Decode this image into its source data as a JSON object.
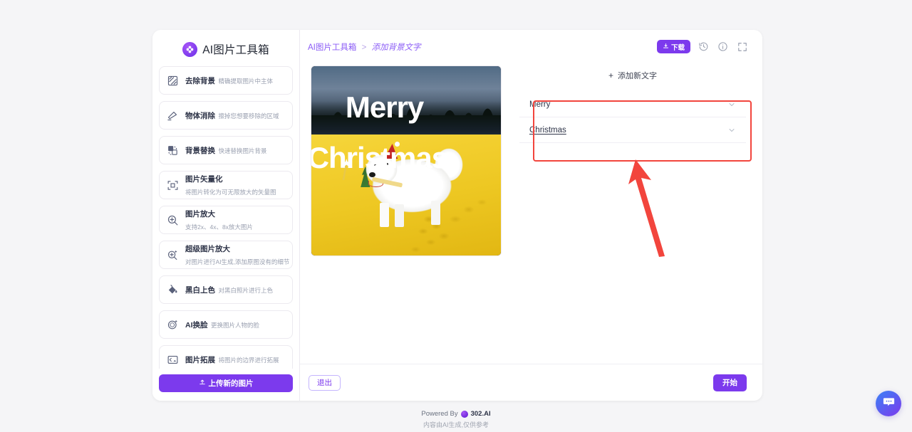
{
  "brand": {
    "title": "AI图片工具箱",
    "logo_icon": "clover-logo-icon"
  },
  "sidebar": {
    "items": [
      {
        "name": "去除背景",
        "desc": "精确提取图片中主体",
        "icon": "remove-background-icon"
      },
      {
        "name": "物体消除",
        "desc": "擦掉您想要移除的区域",
        "icon": "eraser-icon"
      },
      {
        "name": "背景替换",
        "desc": "快速替换图片背景",
        "icon": "background-replace-icon"
      },
      {
        "name": "图片矢量化",
        "desc": "将图片转化为可无限放大的矢量图",
        "icon": "vectorize-icon"
      },
      {
        "name": "图片放大",
        "desc": "支持2x、4x、8x放大图片",
        "icon": "zoom-in-icon"
      },
      {
        "name": "超级图片放大",
        "desc": "对图片进行AI生成,添加原图没有的细节",
        "icon": "super-zoom-icon"
      },
      {
        "name": "黑白上色",
        "desc": "对黑白照片进行上色",
        "icon": "paint-bucket-icon"
      },
      {
        "name": "AI换脸",
        "desc": "更换图片人物的脸",
        "icon": "face-swap-icon"
      },
      {
        "name": "图片拓展",
        "desc": "将图片的边界进行拓展",
        "icon": "image-expand-icon"
      }
    ],
    "upload_label": "上传新的图片",
    "upload_icon": "upload-icon"
  },
  "header": {
    "breadcrumb_root": "AI图片工具箱",
    "breadcrumb_sep": ">",
    "breadcrumb_current": "添加背景文字",
    "download_label": "下载",
    "download_icon": "download-icon",
    "history_icon": "history-icon",
    "info_icon": "info-icon",
    "fullscreen_icon": "fullscreen-icon"
  },
  "preview": {
    "alt": "samoyed-dog-in-santa-hat-on-yellow-snow",
    "overlay_line1": "Merry",
    "overlay_line2": "Christmas"
  },
  "editor": {
    "add_text_label": "添加新文字",
    "add_text_plus": "+",
    "rows": [
      {
        "label": "Merry",
        "chevron": "chevron-down-icon"
      },
      {
        "label": "Christmas",
        "chevron": "chevron-down-icon"
      }
    ]
  },
  "annotation": {
    "box_color": "#f2453d",
    "arrow_color": "#f2453d"
  },
  "actions": {
    "exit_label": "退出",
    "start_label": "开始"
  },
  "footer": {
    "powered_by": "Powered By",
    "brand": "302.AI",
    "disclaimer": "内容由AI生成,仅供参考"
  },
  "chat": {
    "icon": "chat-bubble-icon"
  },
  "theme": {
    "accent": "#7c3aed",
    "link": "#8b5cf6",
    "page_bg": "#f5f5f7",
    "annotation": "#f2453d"
  }
}
